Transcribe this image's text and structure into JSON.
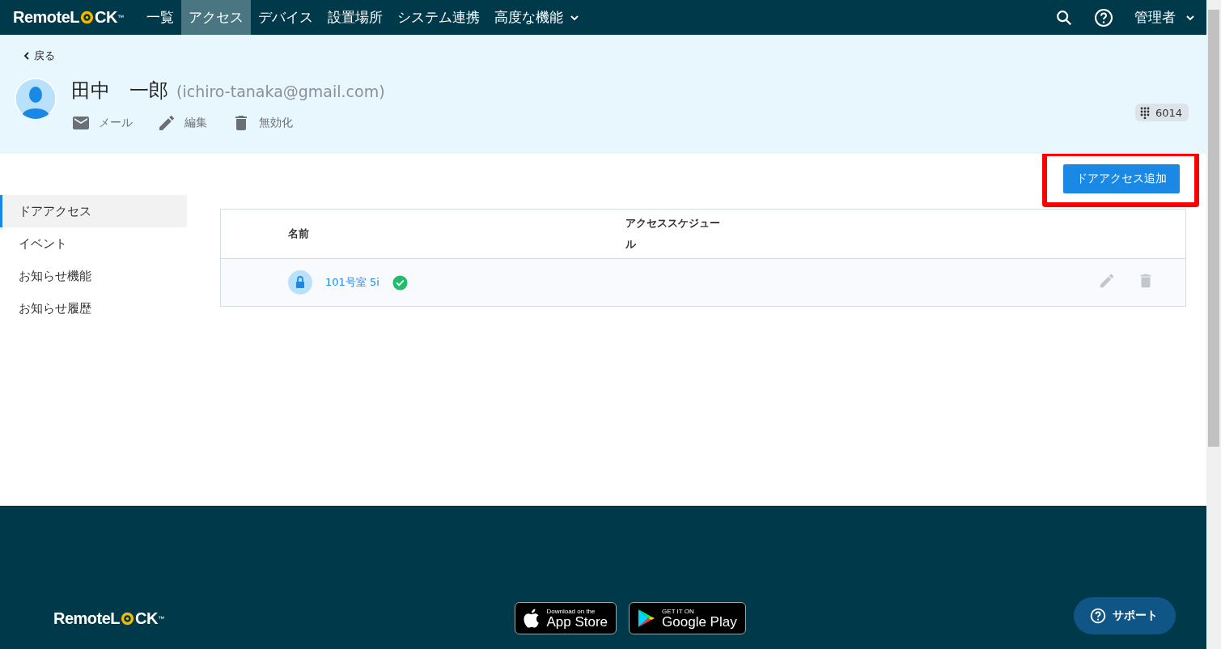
{
  "nav": {
    "logo": {
      "before": "RemoteL",
      "after": "CK",
      "tm": "™"
    },
    "items": [
      {
        "label": "一覧",
        "selected": false
      },
      {
        "label": "アクセス",
        "selected": true
      },
      {
        "label": "デバイス",
        "selected": false
      },
      {
        "label": "設置場所",
        "selected": false
      },
      {
        "label": "システム連携",
        "selected": false
      },
      {
        "label": "高度な機能",
        "selected": false,
        "dropdown": true
      }
    ],
    "user": "管理者"
  },
  "header": {
    "back": "戻る",
    "name": "田中　一郎",
    "email": "(ichiro-tanaka@gmail.com)",
    "actions": [
      {
        "kind": "mail",
        "label": "メール"
      },
      {
        "kind": "edit",
        "label": "編集"
      },
      {
        "kind": "delete",
        "label": "無効化"
      }
    ],
    "pin": "6014"
  },
  "add_button": {
    "label": "ドアアクセス追加",
    "highlighted": true
  },
  "sidebar": {
    "items": [
      {
        "label": "ドアアクセス",
        "selected": true
      },
      {
        "label": "イベント",
        "selected": false
      },
      {
        "label": "お知らせ機能",
        "selected": false
      },
      {
        "label": "お知らせ履歴",
        "selected": false
      }
    ]
  },
  "table": {
    "columns": [
      "名前",
      "アクセススケジュール"
    ],
    "rows": [
      {
        "name": "101号室 5i",
        "ok": true
      }
    ]
  },
  "footer": {
    "logo": {
      "before": "RemoteL",
      "after": "CK",
      "tm": "™"
    },
    "app_store": {
      "small": "Download on the",
      "big": "App Store"
    },
    "google_play": {
      "small": "GET IT ON",
      "big": "Google Play"
    },
    "support": "サポート"
  }
}
